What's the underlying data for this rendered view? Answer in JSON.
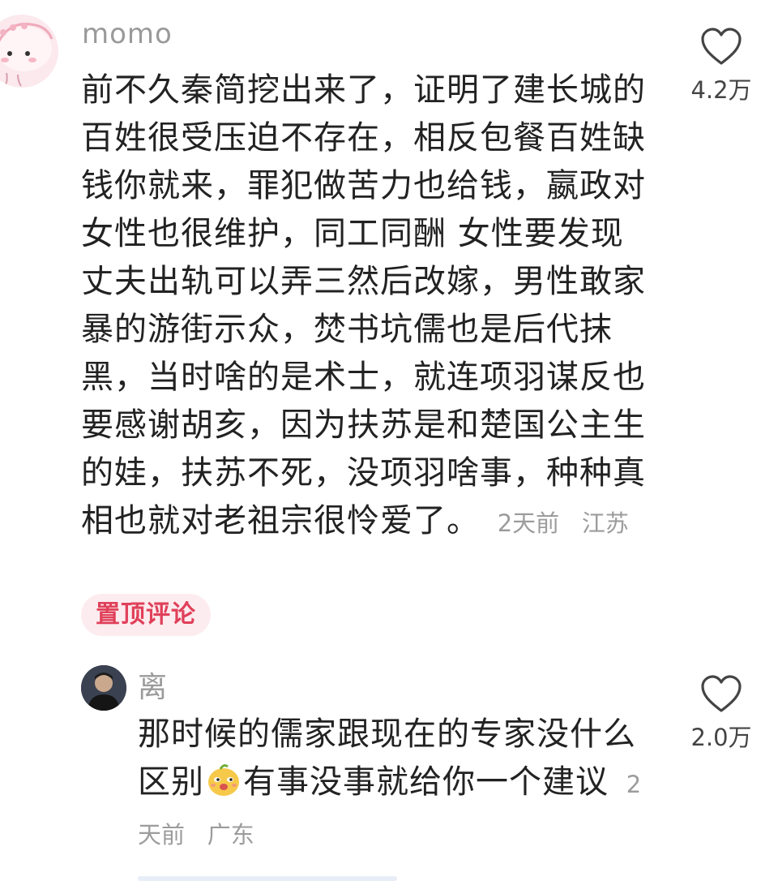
{
  "comment": {
    "username": "momo",
    "text": "前不久秦简挖出来了，证明了建长城的百姓很受压迫不存在，相反包餐百姓缺钱你就来，罪犯做苦力也给钱，嬴政对女性也很维护，同工同酬 女性要发现丈夫出轨可以弄三然后改嫁，男性敢家暴的游街示众，焚书坑儒也是后代抹黑，当时啥的是术士，就连项羽谋反也要感谢胡亥，因为扶苏是和楚国公主生的娃，扶苏不死，没项羽啥事，种种真相也就对老祖宗很怜爱了。",
    "time": "2天前",
    "location": "江苏",
    "likes": "4.2万",
    "badge": "置顶评论"
  },
  "reply": {
    "username": "离",
    "text_before_emoji": "那时候的儒家跟现在的专家没什么区别",
    "emoji_icon": "smug-face-emoji",
    "text_after_emoji": "有事没事就给你一个建议",
    "time": "2天前",
    "location": "广东",
    "likes": "2.0万"
  },
  "colors": {
    "badge_bg": "#fdecef",
    "badge_text": "#e0405a",
    "meta_text": "#9c9c9c"
  }
}
